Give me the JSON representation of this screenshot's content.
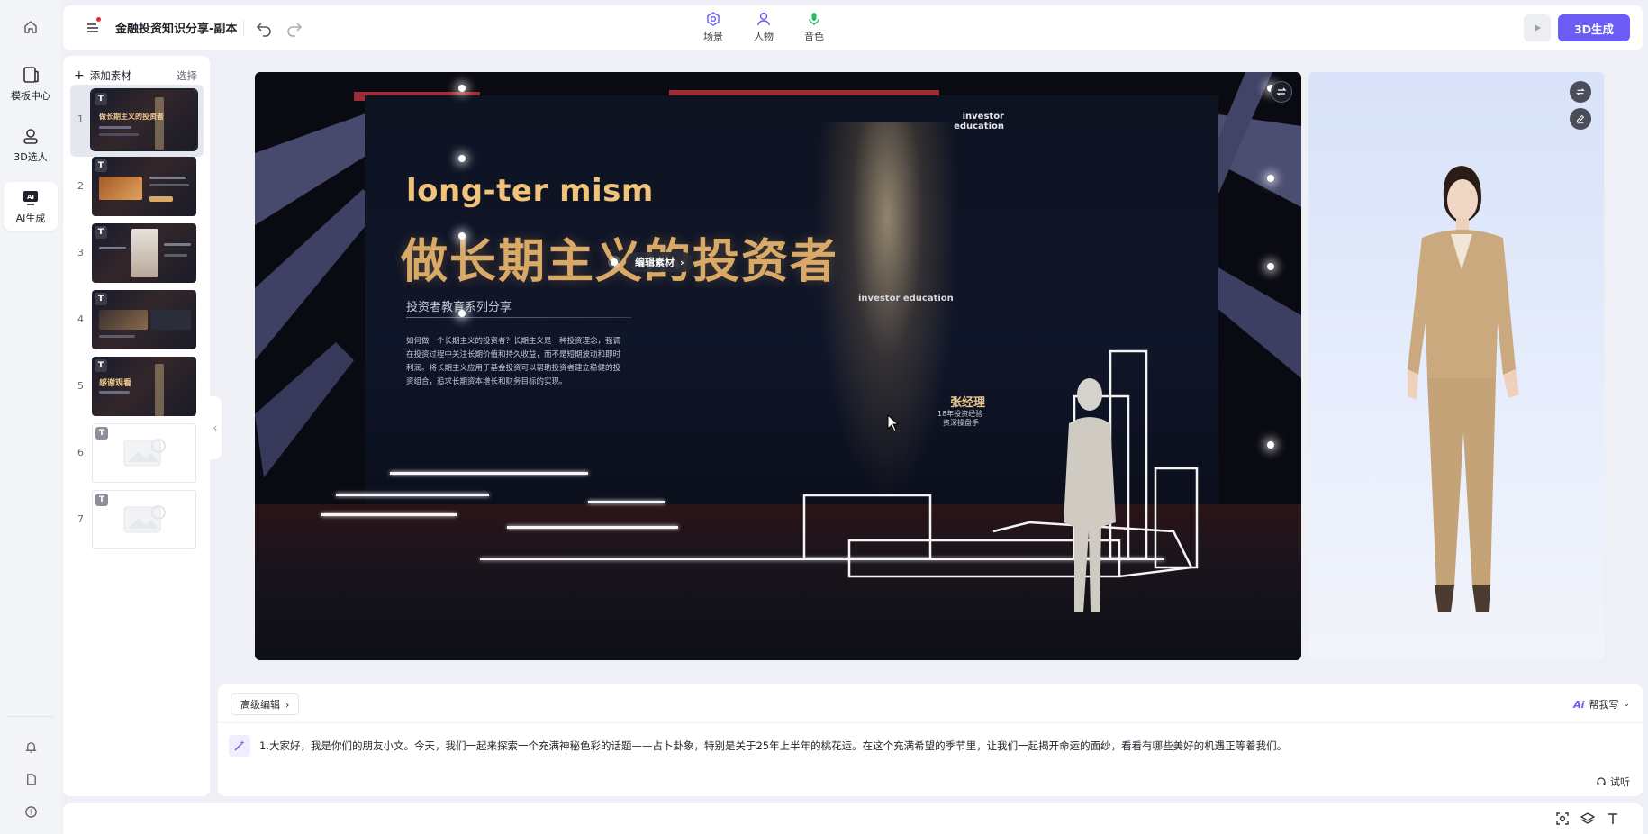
{
  "rail": {
    "items": [
      {
        "label": "模板中心",
        "icon": "template-icon"
      },
      {
        "label": "3D选人",
        "icon": "avatar-select-icon"
      },
      {
        "label": "AI生成",
        "icon": "ai-generate-icon"
      }
    ]
  },
  "topbar": {
    "title": "金融投资知识分享-副本",
    "tabs": [
      {
        "label": "场景",
        "icon": "scene-icon"
      },
      {
        "label": "人物",
        "icon": "person-icon"
      },
      {
        "label": "音色",
        "icon": "microphone-icon"
      }
    ],
    "generate_label": "3D生成"
  },
  "slides": {
    "add_label": "添加素材",
    "select_label": "选择",
    "items": [
      {
        "num": "1",
        "kind": "dark",
        "active": true,
        "thumb_title": "做长期主义的投资者"
      },
      {
        "num": "2",
        "kind": "dark",
        "active": false
      },
      {
        "num": "3",
        "kind": "dark",
        "active": false
      },
      {
        "num": "4",
        "kind": "dark",
        "active": false
      },
      {
        "num": "5",
        "kind": "dark",
        "active": false,
        "thumb_title": "感谢观看"
      },
      {
        "num": "6",
        "kind": "empty",
        "active": false
      },
      {
        "num": "7",
        "kind": "empty",
        "active": false
      }
    ]
  },
  "canvas": {
    "long_term": "long-ter mism",
    "heading": "做长期主义的投资者",
    "subheading": "投资者教育系列分享",
    "paragraph": "如何做一个长期主义的投资者？长期主义是一种投资理念，强调在投资过程中关注长期价值和持久收益，而不是短期波动和即时利润。将长期主义应用于基金投资可以帮助投资者建立稳健的投资组合，追求长期资本增长和财务目标的实现。",
    "investor_education_top": "investor education",
    "investor_education_mid": "investor education",
    "presenter_name": "张经理",
    "presenter_line1": "18年投资经验",
    "presenter_line2": "资深操盘手",
    "edit_label": "编辑素材"
  },
  "script": {
    "advanced_label": "高级编辑",
    "help_write_label": "帮我写",
    "ai_badge": "Ai",
    "text": "1.大家好，我是你们的朋友小文。今天，我们一起来探索一个充满神秘色彩的话题——占卜卦象，特别是关于25年上半年的桃花运。在这个充满希望的季节里，让我们一起揭开命运的面纱，看看有哪些美好的机遇正等着我们。",
    "listen_label": "试听"
  },
  "colors": {
    "accent": "#6b5cf6",
    "gold": "#d9a968",
    "stage_red": "#b8323d"
  }
}
